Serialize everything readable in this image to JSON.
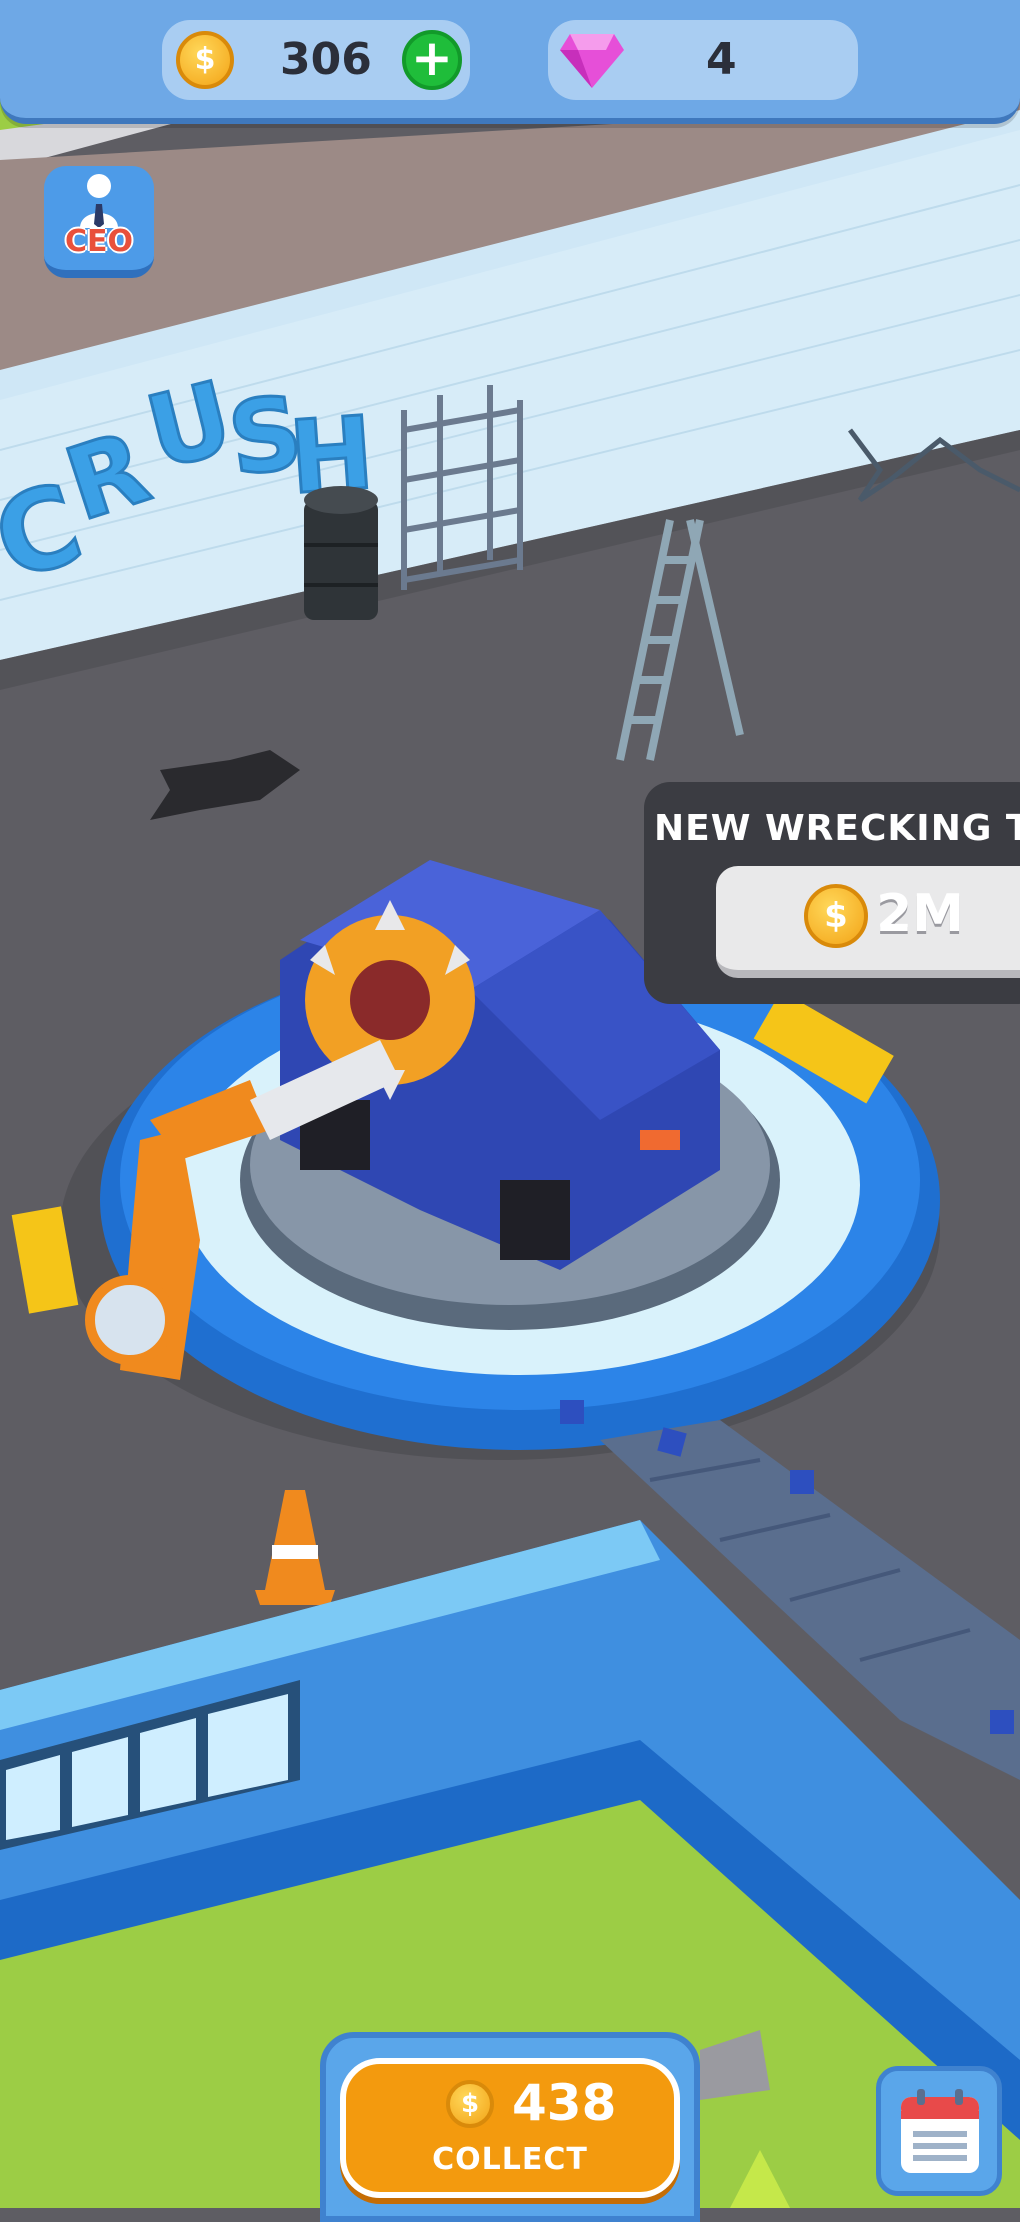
{
  "hud": {
    "coins": "306",
    "gems": "4",
    "coin_icon": "dollar-coin-icon",
    "gem_icon": "pink-gem-icon",
    "add_icon": "plus-icon"
  },
  "ceo_button": {
    "label": "CEO",
    "icon": "businessman-icon"
  },
  "scene": {
    "wall_graffiti": "CRUSH"
  },
  "wreck_panel": {
    "title": "NEW WRECKING T",
    "price": "2M",
    "coin_icon": "dollar-coin-icon"
  },
  "collect": {
    "amount": "438",
    "label": "COLLECT",
    "coin_icon": "dollar-coin-icon"
  },
  "calendar_button": {
    "icon": "calendar-icon"
  },
  "colors": {
    "hud_blue": "#6ea8e6",
    "button_orange": "#f39a0e",
    "accent_green": "#1fbd3a",
    "gem_pink": "#e64fd8",
    "machine_blue": "#2c7fe0",
    "grass_green": "#9ccd45"
  }
}
